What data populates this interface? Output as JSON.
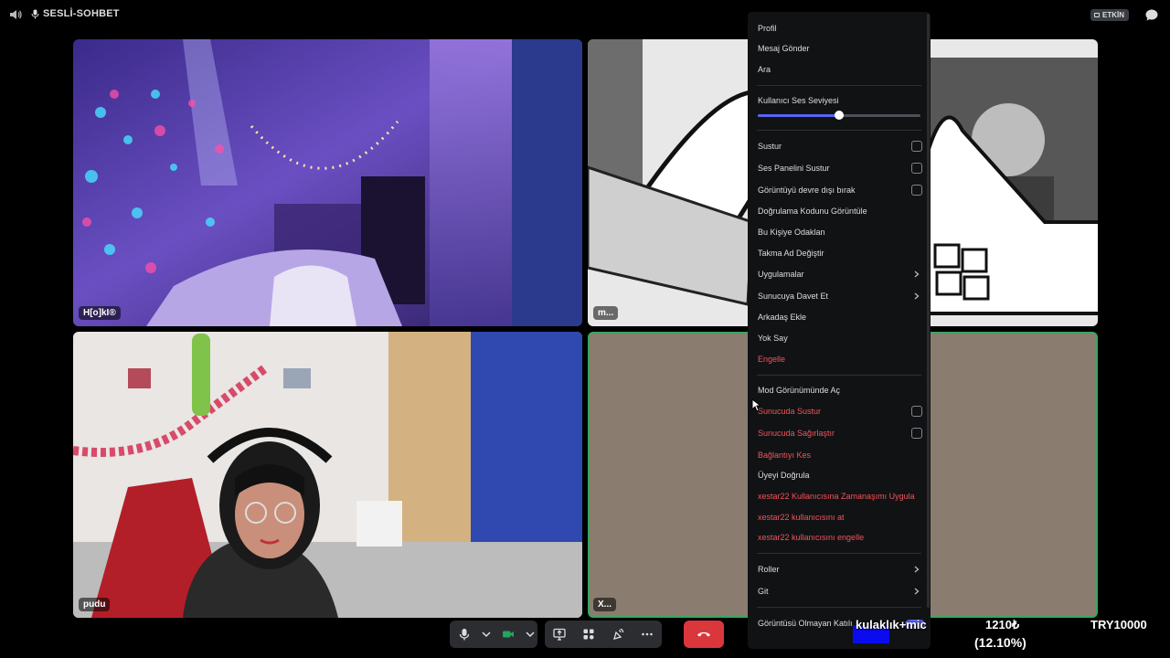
{
  "topbar": {
    "channel_name": "SESLİ-SOHBET",
    "activity_label": "ETKİN"
  },
  "tiles": [
    {
      "name": "H[o]kI®"
    },
    {
      "name": "m..."
    },
    {
      "name": "pudu"
    },
    {
      "name": "X..."
    }
  ],
  "menu": {
    "items_top": [
      "Profil",
      "Mesaj Gönder",
      "Ara"
    ],
    "volume_label": "Kullanıcı Ses Seviyesi",
    "volume_level": 0.5,
    "checkbox_items": [
      "Sustur",
      "Ses Panelini Sustur",
      "Görüntüyü devre dışı bırak"
    ],
    "plain_items": [
      "Doğrulama Kodunu Görüntüle",
      "Bu Kişiye Odaklan",
      "Takma Ad Değiştir"
    ],
    "submenu_items": [
      "Uygulamalar",
      "Sunucuya Davet Et"
    ],
    "more_items": [
      "Arkadaş Ekle",
      "Yok Say"
    ],
    "block": "Engelle",
    "mod_view": "Mod Görünümünde Aç",
    "server_mute": "Sunucuda Sustur",
    "server_deafen": "Sunucuda Sağırlaştır",
    "disconnect": "Bağlantıyı Kes",
    "verify_member": "Üyeyi Doğrula",
    "timeout": "xestar22 Kullanıcısına Zamanaşımı Uygula",
    "kick": "xestar22 kullanıcısını at",
    "ban": "xestar22 kullanıcısını engelle",
    "roles": "Roller",
    "go": "Git",
    "non_video": "Görüntüsü Olmayan Katılı"
  },
  "overlay": {
    "label": "kulaklık+mic",
    "amount": "1210₺",
    "percent": "(12.10%)",
    "goal": "TRY10000"
  },
  "colors": {
    "danger": "#f2545b",
    "accent": "#5865f2",
    "speaking": "#3ba55d",
    "hangup": "#da373c"
  }
}
